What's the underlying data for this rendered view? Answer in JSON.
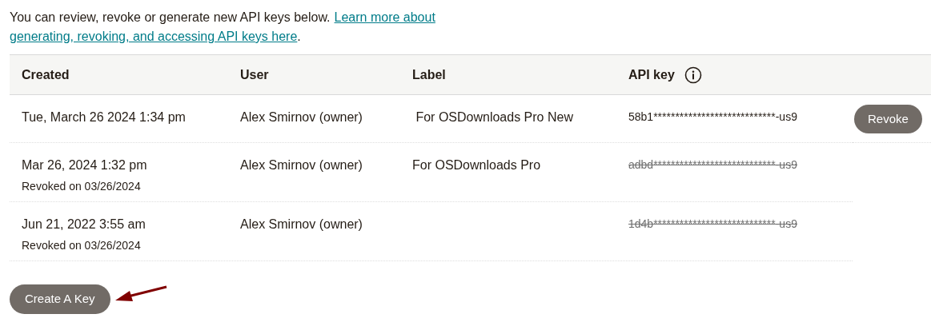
{
  "intro": {
    "text": "You can review, revoke or generate new API keys below.",
    "link_lines": [
      "Learn more about",
      "generating, revoking, and accessing API keys here"
    ],
    "end": "."
  },
  "table": {
    "columns": [
      "Created",
      "User",
      "Label",
      "API key"
    ],
    "rows": [
      {
        "created": "Tue, March 26 2024 1:34 pm",
        "user": "Alex Smirnov (owner)",
        "label": " For OSDownloads Pro New",
        "api_key": "58b1****************************-us9",
        "revoked": false,
        "action": "Revoke"
      },
      {
        "created": "Mar 26, 2024 1:32 pm",
        "revoked_note": "Revoked on 03/26/2024",
        "user": "Alex Smirnov (owner)",
        "label": "For OSDownloads Pro",
        "api_key": "adbd****************************-us9",
        "revoked": true
      },
      {
        "created": "Jun 21, 2022 3:55 am",
        "revoked_note": "Revoked on 03/26/2024",
        "user": "Alex Smirnov (owner)",
        "api_key": "1d4b****************************-us9",
        "revoked": true
      }
    ]
  },
  "create_button": "Create A Key"
}
